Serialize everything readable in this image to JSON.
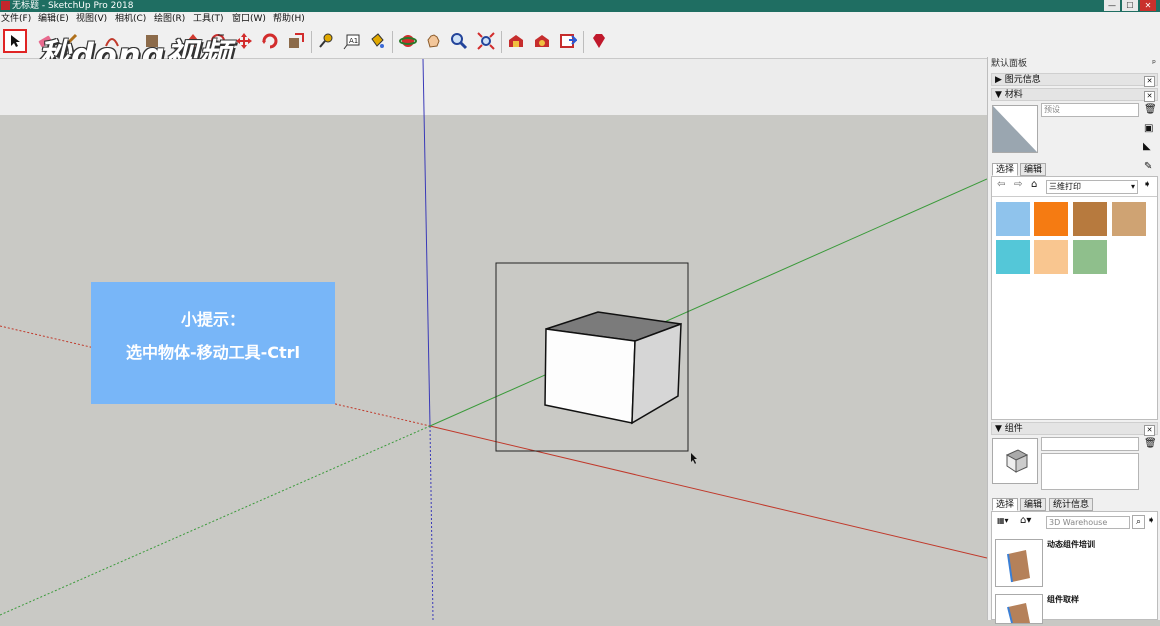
{
  "window": {
    "title": "无标题 - SketchUp Pro 2018",
    "controls": [
      "minimize-icon",
      "maximize-icon",
      "close-icon"
    ]
  },
  "menu": [
    "文件(F)",
    "编辑(E)",
    "视图(V)",
    "相机(C)",
    "绘图(R)",
    "工具(T)",
    "窗口(W)",
    "帮助(H)"
  ],
  "toolbar": {
    "tools": [
      "select-arrow-icon",
      "eraser-icon",
      "pencil-icon",
      "arc-icon",
      "rectangle-icon",
      "push-pull-icon",
      "offset-icon",
      "move-icon",
      "rotate-icon",
      "scale-icon",
      "tape-measure-icon",
      "text-icon",
      "paint-bucket-icon",
      "orbit-icon",
      "pan-icon",
      "zoom-icon",
      "zoom-extents-icon",
      "warehouse-icon",
      "extension-warehouse-icon",
      "layout-icon",
      "ruby-icon"
    ],
    "selected_tool": "select-arrow-icon"
  },
  "watermark": "秒dong视频",
  "tip": {
    "line1": "小提示：",
    "line2": "选中物体-移动工具-Ctrl"
  },
  "tray": {
    "title": "默认面板",
    "entity_info": "图元信息",
    "materials": {
      "header": "材料",
      "name_placeholder": "预设",
      "tabs": [
        "选择",
        "编辑"
      ],
      "collection": "三维打印",
      "swatches": [
        "#8fc3ec",
        "#f57b12",
        "#b77a3e",
        "#cfa373",
        "#54c7d8",
        "#f9c690",
        "#8fbf8c"
      ]
    },
    "components": {
      "header": "组件",
      "tabs": [
        "选择",
        "编辑",
        "统计信息"
      ],
      "search_placeholder": "3D Warehouse",
      "items": [
        "动态组件培训",
        "组件取样"
      ]
    }
  },
  "colors": {
    "titlebar": "#1f6e62",
    "tip_box": "#78b6f8",
    "selected_tool_border": "#e02424",
    "axis_red": "#c0392b",
    "axis_green": "#3a9a3a",
    "axis_blue": "#3a3ab8"
  }
}
